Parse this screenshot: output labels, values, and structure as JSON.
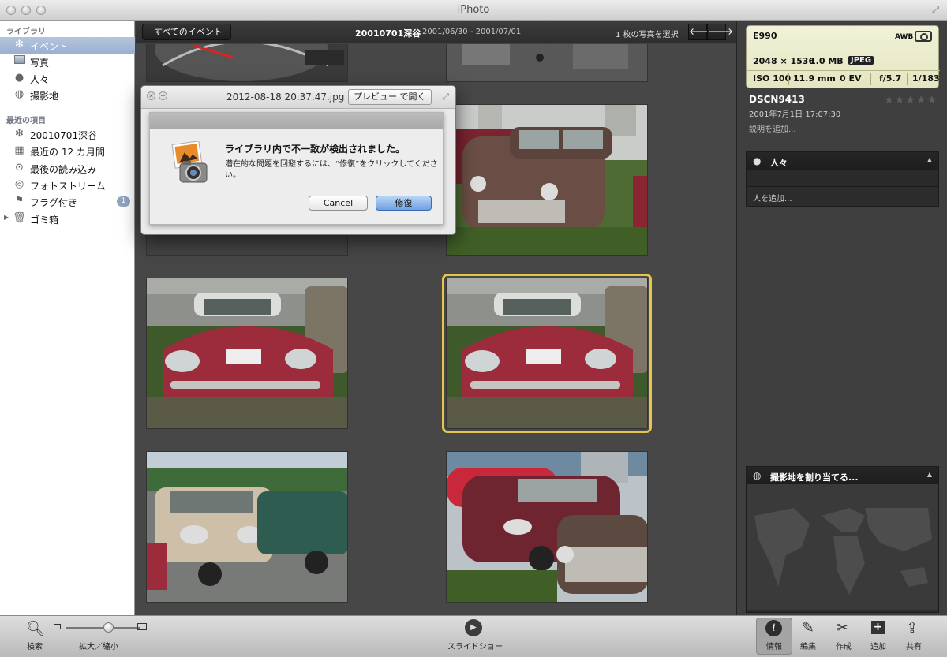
{
  "window": {
    "title": "iPhoto"
  },
  "sidebar": {
    "library_header": "ライブラリ",
    "library_items": [
      {
        "label": "イベント",
        "icon": "palm-tree-icon",
        "selected": true
      },
      {
        "label": "写真",
        "icon": "photo-icon"
      },
      {
        "label": "人々",
        "icon": "person-icon"
      },
      {
        "label": "撮影地",
        "icon": "globe-icon"
      }
    ],
    "recent_header": "最近の項目",
    "recent_items": [
      {
        "label": "20010701深谷",
        "icon": "palm-tree-icon"
      },
      {
        "label": "最近の 12 カ月間",
        "icon": "calendar-icon"
      },
      {
        "label": "最後の読み込み",
        "icon": "import-icon"
      },
      {
        "label": "フォトストリーム",
        "icon": "photostream-icon"
      },
      {
        "label": "フラグ付き",
        "icon": "flag-icon",
        "badge": "1"
      },
      {
        "label": "ゴミ箱",
        "icon": "trash-icon",
        "disclosure": "▶"
      }
    ]
  },
  "topbar": {
    "back_label": "すべてのイベント",
    "event_title": "20010701深谷",
    "event_dates": "2001/06/30 - 2001/07/01",
    "selection_count": "1 枚の写真を選択",
    "prev_icon": "arrow-left-icon",
    "next_icon": "arrow-right-icon"
  },
  "info": {
    "camera": "E990",
    "white_balance": "AWB",
    "resolution": "2048 × 1536",
    "file_size": "1.0 MB",
    "format": "JPEG",
    "iso": "ISO 100",
    "focal_length": "11.9 mm",
    "exposure_bias": "0 EV",
    "aperture": "f/5.7",
    "shutter": "1/183",
    "photo_name": "DSCN9413",
    "photo_date": "2001年7月1日 17:07:30",
    "add_description": "説明を追加...",
    "rating_stars": "★★★★★",
    "people_title": "人々",
    "add_people": "人を追加...",
    "places_title": "撮影地を割り当てる...",
    "collapse_icon": "▲"
  },
  "bottombar": {
    "search_label": "検索",
    "zoom_label": "拡大／縮小",
    "zoom_level": 0.57,
    "slideshow_label": "スライドショー",
    "info_label": "情報",
    "edit_label": "編集",
    "create_label": "作成",
    "add_label": "追加",
    "share_label": "共有"
  },
  "dialog": {
    "filename": "2012-08-18 20.37.47.jpg",
    "preview_button": "プレビュー で開く",
    "alert_title": "ライブラリ内で不一致が検出されました。",
    "alert_body": "潜在的な問題を回避するには、“修復”をクリックしてください。",
    "cancel_label": "Cancel",
    "repair_label": "修復"
  },
  "colors": {
    "selection_outline": "#e7c44a",
    "sidebar_selected": "#9bb1d2",
    "metadata_box": "#e4e6c0",
    "default_button": "#6fa1e3"
  }
}
